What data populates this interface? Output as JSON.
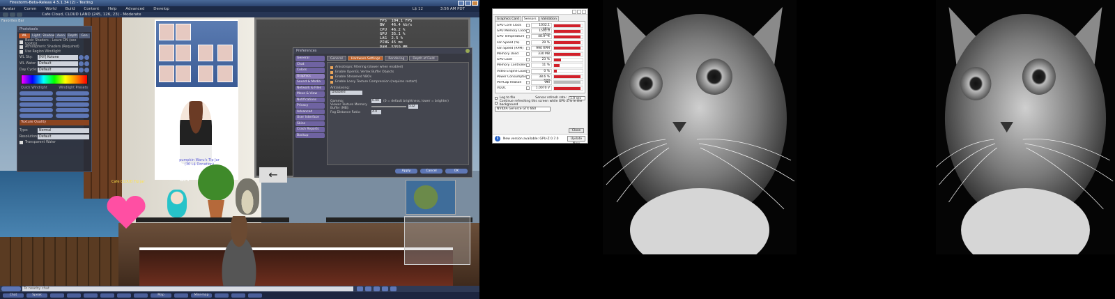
{
  "viewer": {
    "title": "Firestorm-Beta-Releas 4.5.1.34 (2) - Testing",
    "menu": [
      "Avatar",
      "Comm",
      "World",
      "Build",
      "Content",
      "Help",
      "Advanced",
      "Develop"
    ],
    "balance": "L$ 12",
    "clock": "3:56 AM PDT",
    "location": "Cafe Cloud, CLOUD LAND (245, 126, 23) - Moderate",
    "favorites_label": "Favorites Bar",
    "hud_stats": "FPS  104.1 FPS\nBW   46.4 kb/s\nCPU  46.2 %\nGPU  35.1 %\nLAG  2.5 %\nPING 45 ms\nRAM  5359 MB",
    "sign_off": "OFF",
    "blue_label": "Cafe CLOUD Tip jar",
    "booth_label": "pumpkin Waru's Tip Jar\n(30 L$ Donation)",
    "chat_placeholder": "To nearby chat",
    "toolbar_buttons": [
      "Chat",
      "Speak",
      "",
      "",
      "",
      "",
      "",
      "",
      "Map",
      "",
      "Mini-map",
      "",
      "",
      ""
    ]
  },
  "photo_floater": {
    "title": "Phototools",
    "tabs": [
      "WL",
      "Light",
      "Shadow",
      "Aven",
      "Depth",
      "Gen"
    ],
    "checks": [
      "Basic Shaders - Leave ON (see tooltip)",
      "Atmospheric Shaders (Required)",
      "Use Region Windlight"
    ],
    "fields": [
      {
        "label": "WL Sky:",
        "value": "[NY] Kotone Neuvolleet_0"
      },
      {
        "label": "WL Water:",
        "value": "Default"
      },
      {
        "label": "Day Cycle:",
        "value": "Default"
      }
    ],
    "section_quick": "Quick Windlight",
    "section_presets": "Windlight Presets",
    "section_orange": "Texture Quality",
    "type_label": "Type:",
    "type_value": "Normal",
    "res_label": "Resolution:",
    "res_value": "Default",
    "transparent_label": "Transparent Water"
  },
  "prefs": {
    "title": "Preferences",
    "side_items": [
      "General",
      "Chat",
      "Colors",
      "Graphics",
      "Sound & Media",
      "Network & Files",
      "Move & View",
      "Notifications",
      "Privacy",
      "Advanced",
      "User Interface",
      "Skins",
      "Crash Reports",
      "Backup"
    ],
    "selected_side": "Graphics",
    "tabs": [
      "General",
      "Hardware Settings",
      "Rendering",
      "Depth of Field"
    ],
    "selected_tab": "Hardware Settings",
    "options": [
      "Anisotropic Filtering (slower when enabled)",
      "Enable OpenGL Vertex Buffer Objects",
      "Enable Streamed VBOs",
      "Enable Lossy Texture Compression (requires restart)"
    ],
    "antialias_label": "Antialiasing:",
    "antialias_value": "Disabled",
    "gamma_label": "Gamma:",
    "gamma_value": "0.00",
    "gamma_hint": "(0 = default brightness, lower = brighter)",
    "vram_label": "Viewer Texture Memory Buffer (MB):",
    "vram_value": "512",
    "fog_label": "Fog Distance Ratio:",
    "fog_value": "4.0",
    "buttons": [
      "Apply",
      "Cancel",
      "OK"
    ]
  },
  "gpuz": {
    "tabs": [
      "Graphics Card",
      "Sensors",
      "Validation"
    ],
    "selected_tab": "Sensors",
    "sensors": [
      {
        "name": "GPU Core Clock",
        "value": "1032.1 MHz",
        "level": 0.92
      },
      {
        "name": "GPU Memory Clock",
        "value": "1502.3 MHz",
        "level": 0.92
      },
      {
        "name": "GPU Temperature",
        "value": "48.0 °C",
        "level": 0.92
      },
      {
        "name": "Fan Speed (%)",
        "value": "29 %",
        "level": 0.92
      },
      {
        "name": "Fan Speed (RPM)",
        "value": "990 RPM",
        "level": 0.92
      },
      {
        "name": "Memory Used",
        "value": "330 MB",
        "level": 0.92
      },
      {
        "name": "GPU Load",
        "value": "23 %",
        "level": 0.25
      },
      {
        "name": "Memory Controller Load",
        "value": "11 %",
        "level": 0.2
      },
      {
        "name": "Video Engine Load",
        "value": "0 %",
        "level": 0.1
      },
      {
        "name": "Power Consumption",
        "value": "38.6 % TDP",
        "level": 0.92
      },
      {
        "name": "PerfCap Reason",
        "value": "Util",
        "level": 0.92,
        "gray": true
      },
      {
        "name": "VDDC",
        "value": "1.0070 V",
        "level": 0.92
      }
    ],
    "log_label": "Log to file",
    "refresh_label": "Sensor refresh rate:",
    "refresh_value": "1.0 sec",
    "continue_label": "Continue refreshing this screen while GPU-Z is in the background",
    "gpu_name": "NVIDIA GeForce GTX 660",
    "close_label": "Close",
    "notice": "New version available: GPU-Z 0.7.0",
    "update_label": "Update Now"
  },
  "colors": {
    "accent_orange": "#c3642b",
    "gauge_red": "#d2202a",
    "button_blue": "#5e77b6",
    "pref_purple": "#6f63a2"
  }
}
